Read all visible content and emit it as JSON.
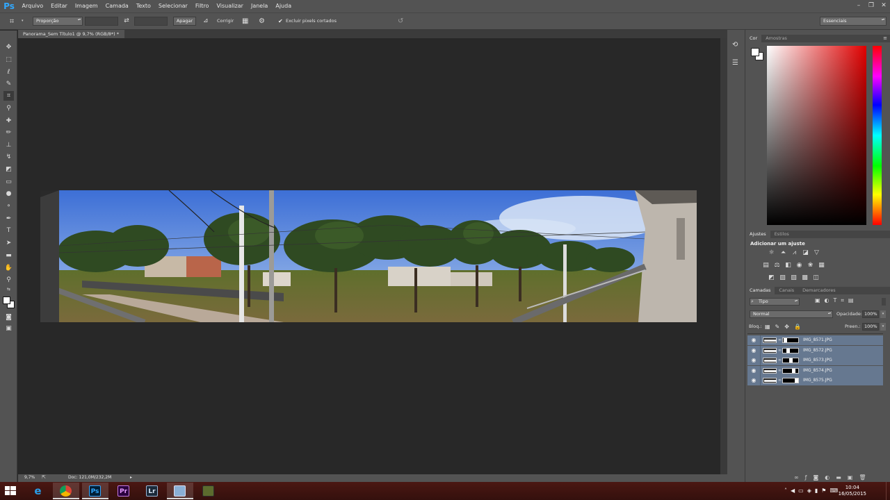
{
  "app": {
    "logo": "Ps"
  },
  "menu": [
    "Arquivo",
    "Editar",
    "Imagem",
    "Camada",
    "Texto",
    "Selecionar",
    "Filtro",
    "Visualizar",
    "Janela",
    "Ajuda"
  ],
  "window_controls": [
    "–",
    "❐",
    "✕"
  ],
  "options_bar": {
    "ratio_select": "Proporção",
    "clear_button": "Apagar",
    "straighten_label": "Corrigir",
    "delete_cropped_label": "Excluir pixels cortados",
    "delete_cropped_checked": true,
    "workspace": "Essenciais"
  },
  "document": {
    "tab_title": "Panorama_Sem Título1 @ 9,7% (RGB/8*) *",
    "zoom": "9,7%",
    "doc_size": "Doc: 121,0M/232,2M"
  },
  "color_panel": {
    "tabs": [
      "Cor",
      "Amostras"
    ],
    "foreground": "#ffffff",
    "background": "#ffffff",
    "hue_color": "#ff0000"
  },
  "adjustments_panel": {
    "tabs": [
      "Ajustes",
      "Estilos"
    ],
    "title": "Adicionar um ajuste"
  },
  "layers_panel": {
    "tabs": [
      "Camadas",
      "Canais",
      "Demarcadores"
    ],
    "filter_kind": "Tipo",
    "blend_mode": "Normal",
    "opacity_label": "Opacidade:",
    "opacity": "100%",
    "lock_label": "Bloq.:",
    "fill_label": "Preen.:",
    "fill": "100%",
    "layers": [
      {
        "name": "IMG_8571.JPG"
      },
      {
        "name": "IMG_8572.JPG"
      },
      {
        "name": "IMG_8573.JPG"
      },
      {
        "name": "IMG_8574.JPG"
      },
      {
        "name": "IMG_8575.JPG"
      }
    ]
  },
  "taskbar": {
    "apps": [
      "internet-explorer",
      "chrome",
      "photoshop",
      "premiere",
      "lightroom",
      "photo-viewer",
      "file-tool"
    ],
    "app_labels": {
      "photoshop": "Ps",
      "premiere": "Pr",
      "lightroom": "Lr"
    },
    "time": "10:04",
    "date": "16/05/2015"
  }
}
